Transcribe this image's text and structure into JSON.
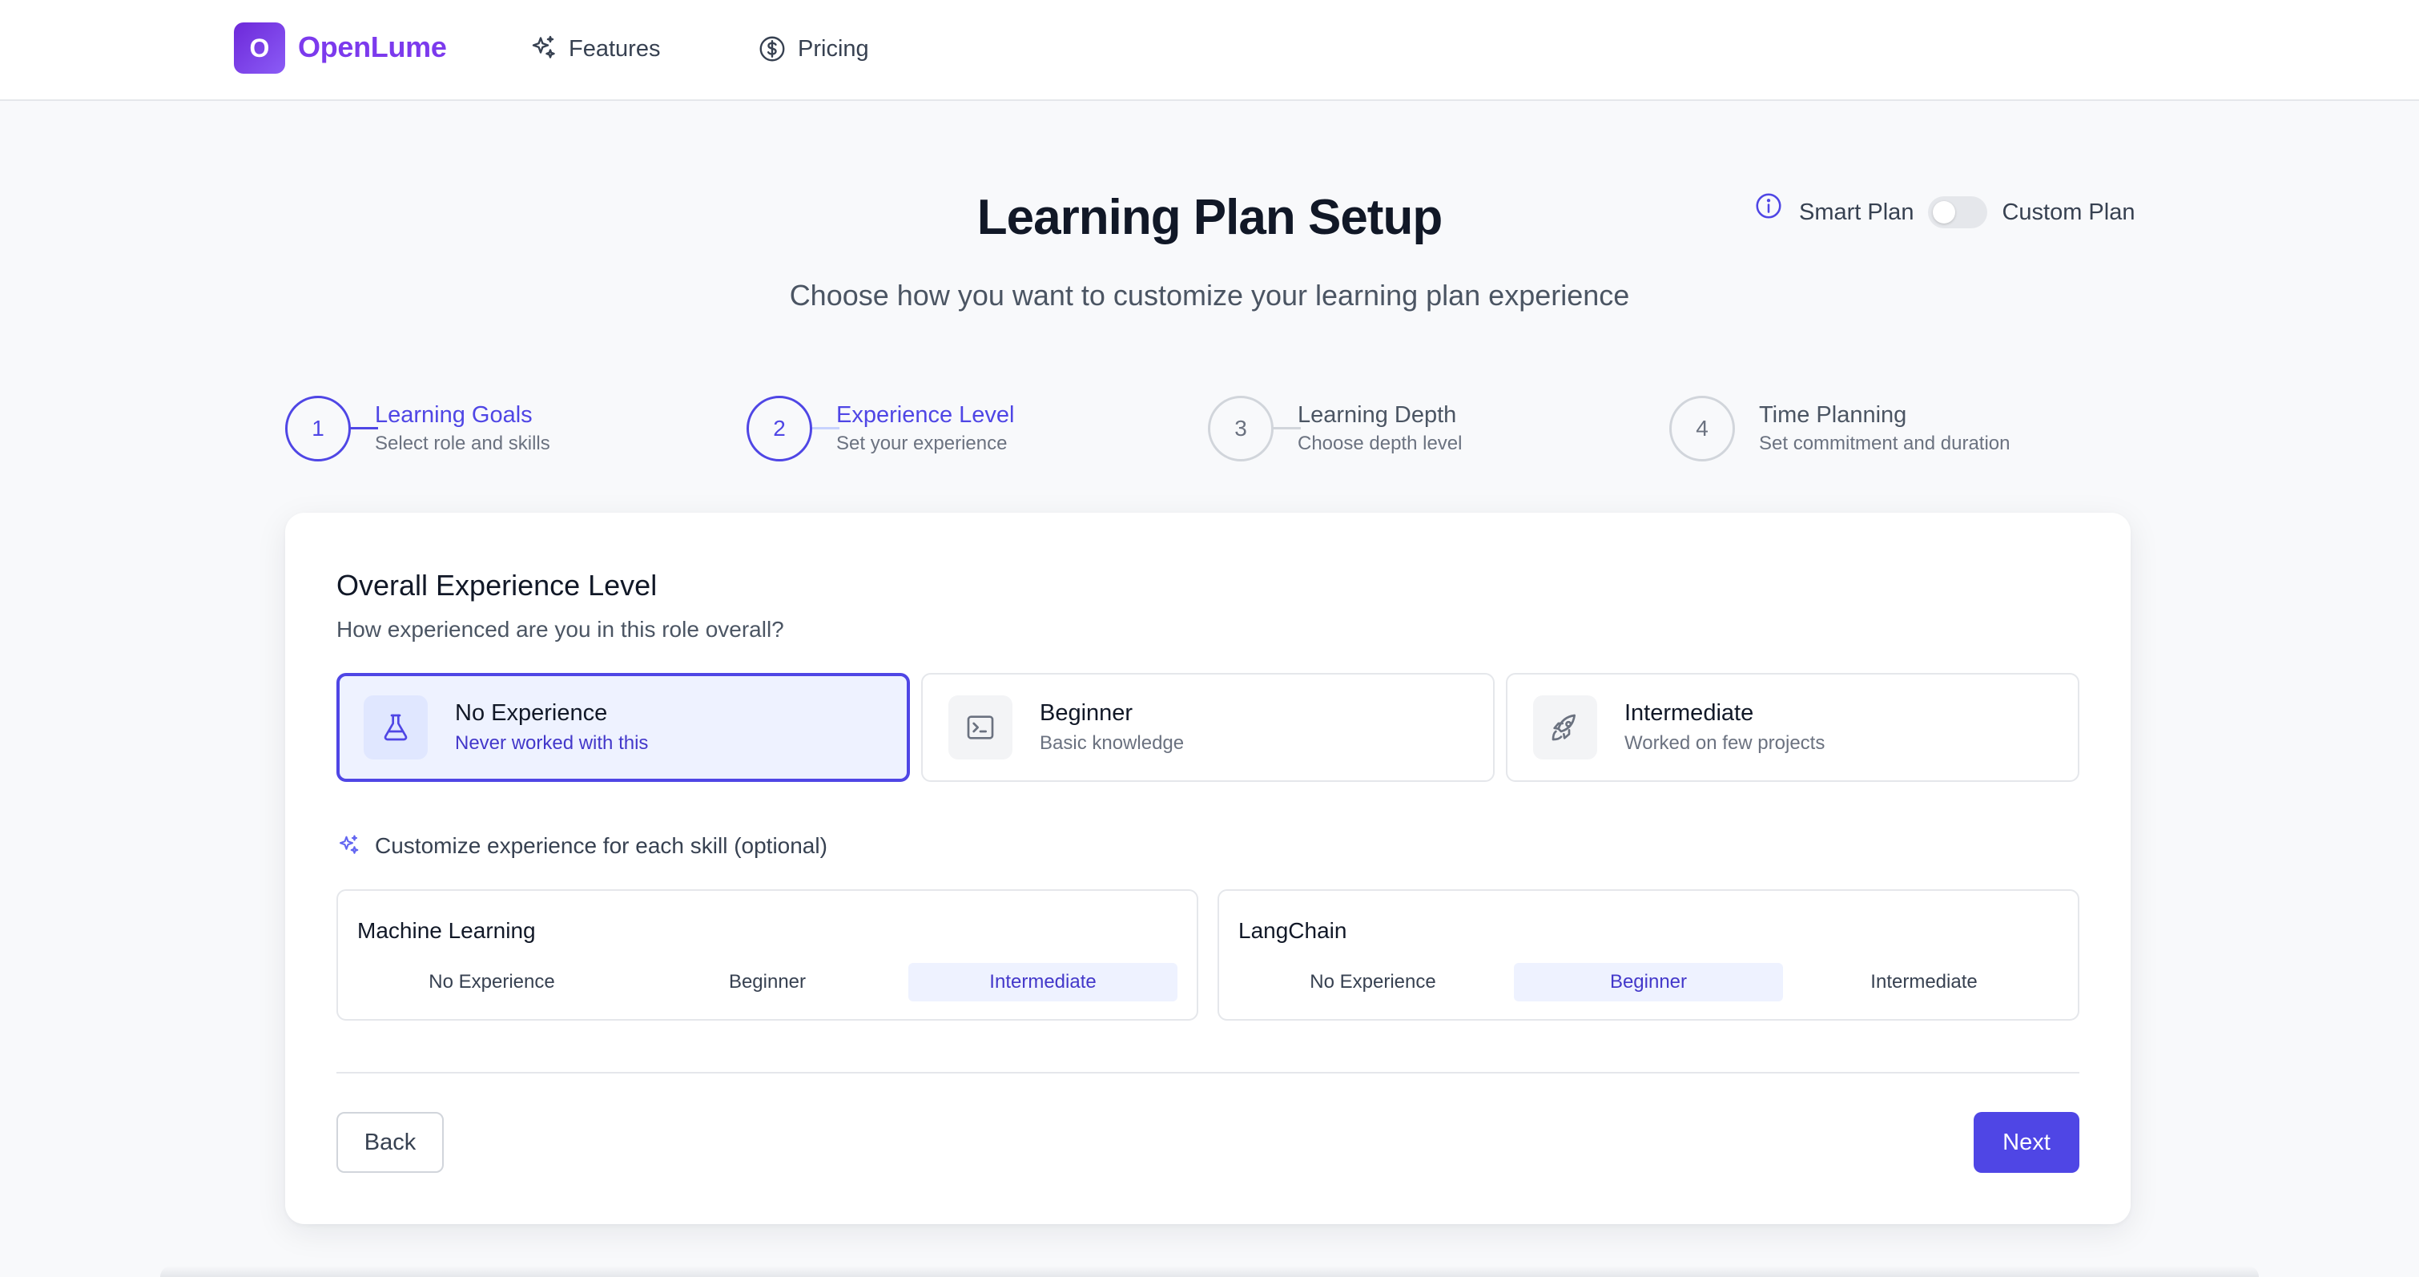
{
  "nav": {
    "logo_letter": "O",
    "brand": "OpenLume",
    "features_label": "Features",
    "pricing_label": "Pricing"
  },
  "header": {
    "title": "Learning Plan Setup",
    "subtitle": "Choose how you want to customize your learning plan experience",
    "plan_toggle": {
      "left_label": "Smart Plan",
      "right_label": "Custom Plan",
      "custom_enabled": false
    }
  },
  "steps": [
    {
      "number": "1",
      "title": "Learning Goals",
      "desc": "Select role and skills",
      "state": "completed"
    },
    {
      "number": "2",
      "title": "Experience Level",
      "desc": "Set your experience",
      "state": "current"
    },
    {
      "number": "3",
      "title": "Learning Depth",
      "desc": "Choose depth level",
      "state": "upcoming"
    },
    {
      "number": "4",
      "title": "Time Planning",
      "desc": "Set commitment and duration",
      "state": "upcoming"
    }
  ],
  "card": {
    "title": "Overall Experience Level",
    "subtitle": "How experienced are you in this role overall?",
    "levels": [
      {
        "title": "No Experience",
        "desc": "Never worked with this",
        "icon": "flask-icon",
        "selected": true
      },
      {
        "title": "Beginner",
        "desc": "Basic knowledge",
        "icon": "terminal-icon",
        "selected": false
      },
      {
        "title": "Intermediate",
        "desc": "Worked on few projects",
        "icon": "rocket-icon",
        "selected": false
      }
    ],
    "customize_label": "Customize experience for each skill (optional)",
    "skills": [
      {
        "name": "Machine Learning",
        "options": [
          "No Experience",
          "Beginner",
          "Intermediate"
        ],
        "selected": "Intermediate"
      },
      {
        "name": "LangChain",
        "options": [
          "No Experience",
          "Beginner",
          "Intermediate"
        ],
        "selected": "Beginner"
      }
    ],
    "back_label": "Back",
    "next_label": "Next"
  },
  "colors": {
    "accent": "#4f46e5",
    "brand": "#7c3aed",
    "selected_bg": "#eef2ff"
  }
}
